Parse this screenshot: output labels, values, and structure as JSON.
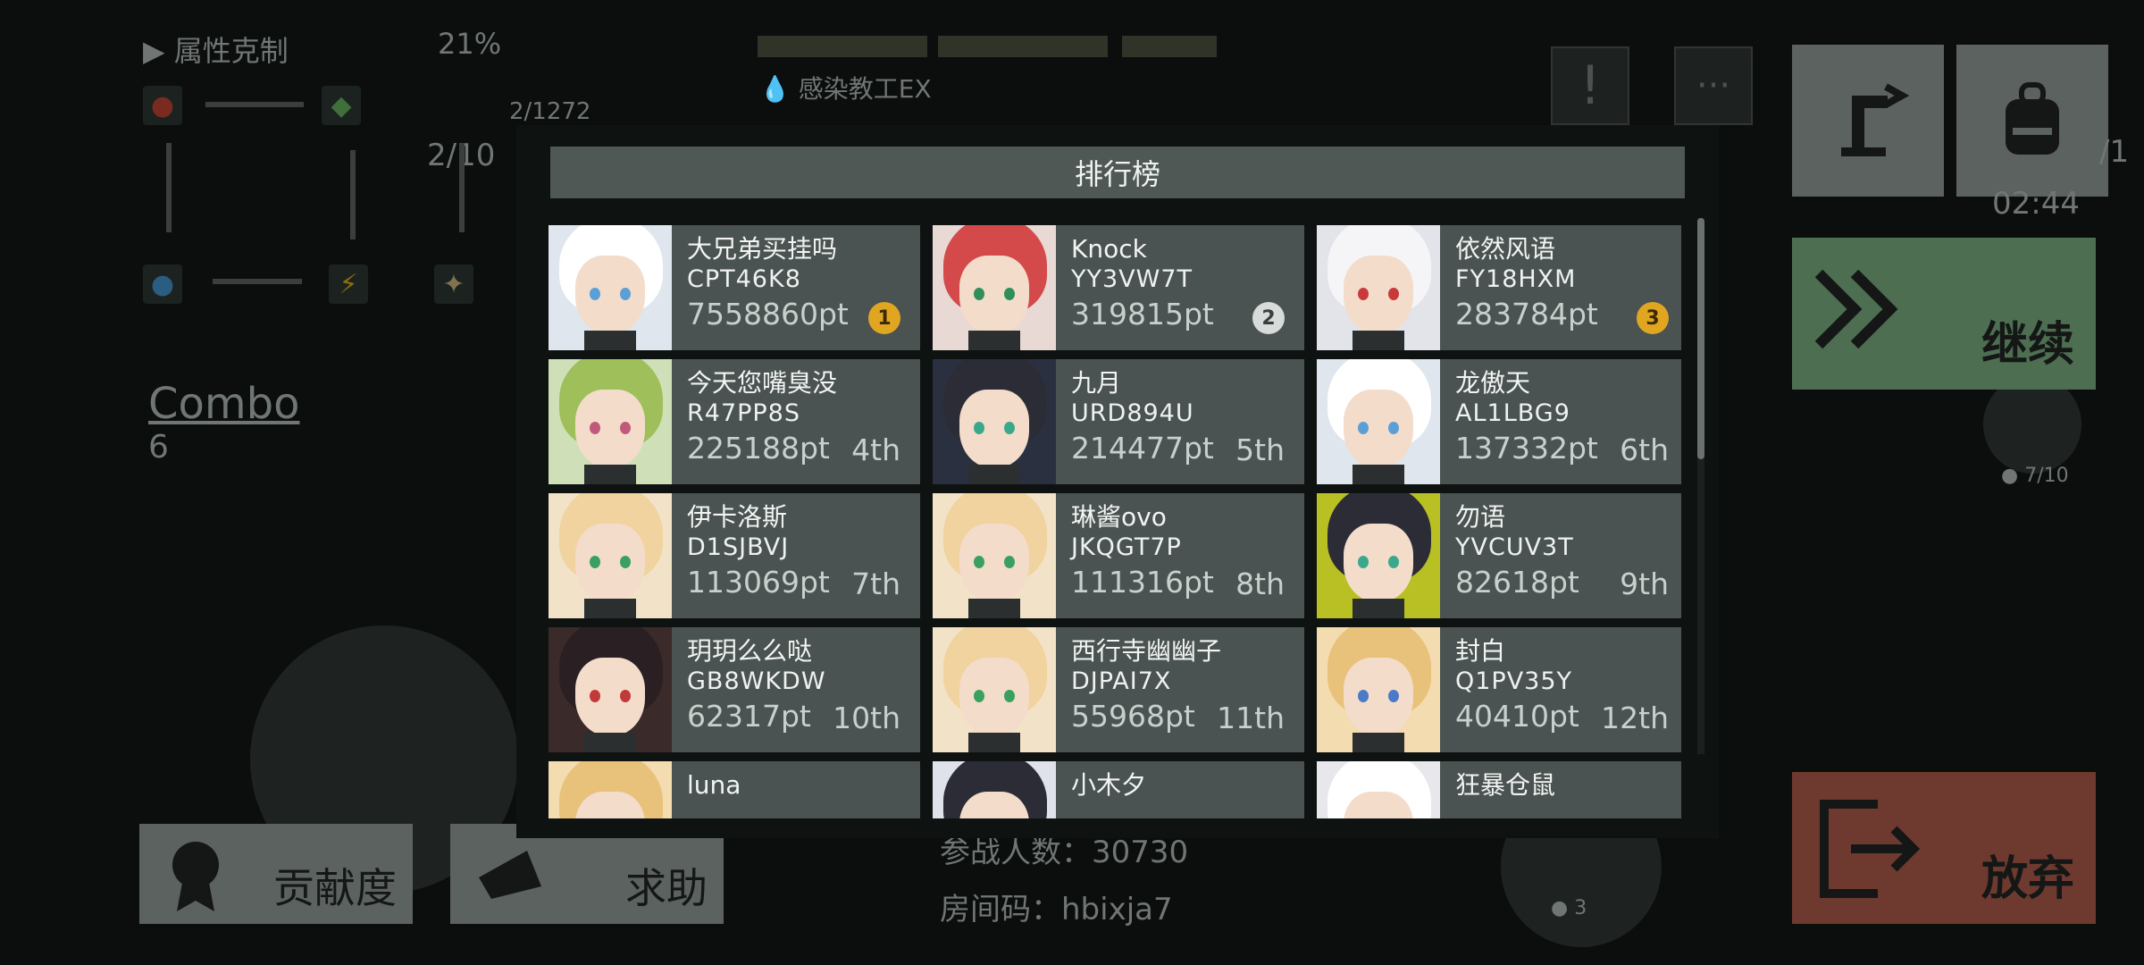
{
  "hud": {
    "attribute_label": "属性克制",
    "attribute_percent": "21%",
    "resource_count": "2/1272",
    "level_fraction": "2/10",
    "combo_label": "Combo",
    "combo_value": "6",
    "stage_name": "感染教工EX",
    "timer": "02:44",
    "wave": "7/10",
    "small_count": "3",
    "participants_label": "参战人数：30730",
    "room_code_label": "房间码：hbixja7",
    "side_fraction": "/1"
  },
  "buttons": {
    "continue": "继续",
    "give_up": "放弃",
    "contribution": "贡献度",
    "help": "求助"
  },
  "leaderboard": {
    "title": "排行榜",
    "entries": [
      {
        "name": "大兄弟买挂吗",
        "id": "CPT46K8",
        "points": "7558860pt",
        "rank": "1",
        "medal": "gold"
      },
      {
        "name": "Knock",
        "id": "YY3VW7T",
        "points": "319815pt",
        "rank": "2",
        "medal": "silver"
      },
      {
        "name": "依然风语",
        "id": "FY18HXM",
        "points": "283784pt",
        "rank": "3",
        "medal": "gold"
      },
      {
        "name": "今天您嘴臭没",
        "id": "R47PP8S",
        "points": "225188pt",
        "rank": "4th"
      },
      {
        "name": "九月",
        "id": "URD894U",
        "points": "214477pt",
        "rank": "5th"
      },
      {
        "name": "龙傲天",
        "id": "AL1LBG9",
        "points": "137332pt",
        "rank": "6th"
      },
      {
        "name": "伊卡洛斯",
        "id": "D1SJBVJ",
        "points": "113069pt",
        "rank": "7th"
      },
      {
        "name": "琳酱ovo",
        "id": "JKQGT7P",
        "points": "111316pt",
        "rank": "8th"
      },
      {
        "name": "勿语",
        "id": "YVCUV3T",
        "points": "82618pt",
        "rank": "9th"
      },
      {
        "name": "玥玥么么哒",
        "id": "GB8WKDW",
        "points": "62317pt",
        "rank": "10th"
      },
      {
        "name": "西行寺幽幽子",
        "id": "DJPAI7X",
        "points": "55968pt",
        "rank": "11th"
      },
      {
        "name": "封白",
        "id": "Q1PV35Y",
        "points": "40410pt",
        "rank": "12th"
      },
      {
        "name": "luna",
        "id": "",
        "points": "",
        "rank": ""
      },
      {
        "name": "小木夕",
        "id": "",
        "points": "",
        "rank": ""
      },
      {
        "name": "狂暴仓鼠",
        "id": "",
        "points": "",
        "rank": ""
      }
    ]
  },
  "colors": {
    "continue_bg": "#4d6e51",
    "give_up_bg": "#6e3a2f",
    "card_bg": "#4a5351",
    "header_bg": "#4f5855"
  }
}
